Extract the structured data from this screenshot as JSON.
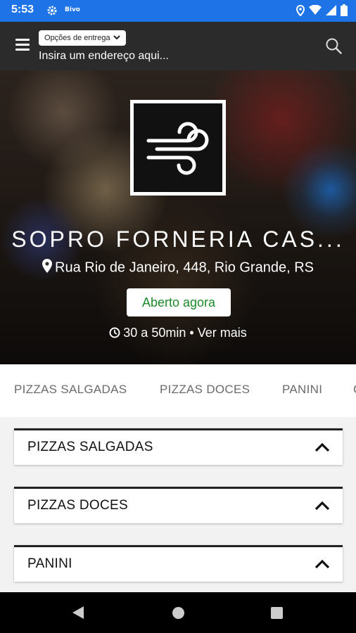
{
  "status_bar": {
    "time": "5:53",
    "app_indicator": "Bivo",
    "icons": [
      "gear-icon",
      "location-icon",
      "wifi-icon",
      "signal-icon",
      "battery-icon"
    ]
  },
  "app_bar": {
    "delivery_chip_label": "Opções de entrega",
    "address_placeholder": "Insira um endereço aqui...",
    "icons": [
      "menu-icon",
      "search-icon",
      "chevron-down-icon"
    ]
  },
  "restaurant": {
    "name": "SOPRO FORNERIA CAS...",
    "address": "Rua Rio de Janeiro, 448, Rio Grande, RS",
    "status": "Aberto agora",
    "delivery_time": "30 a 50min",
    "separator": "•",
    "more_link": "Ver mais",
    "status_color": "#1c8a2a"
  },
  "category_tabs": [
    "PIZZAS SALGADAS",
    "PIZZAS DOCES",
    "PANINI"
  ],
  "sections": [
    {
      "title": "PIZZAS SALGADAS"
    },
    {
      "title": "PIZZAS DOCES"
    },
    {
      "title": "PANINI"
    }
  ],
  "colors": {
    "status_bar": "#1e73e6",
    "app_bar": "#2b2b2b"
  }
}
